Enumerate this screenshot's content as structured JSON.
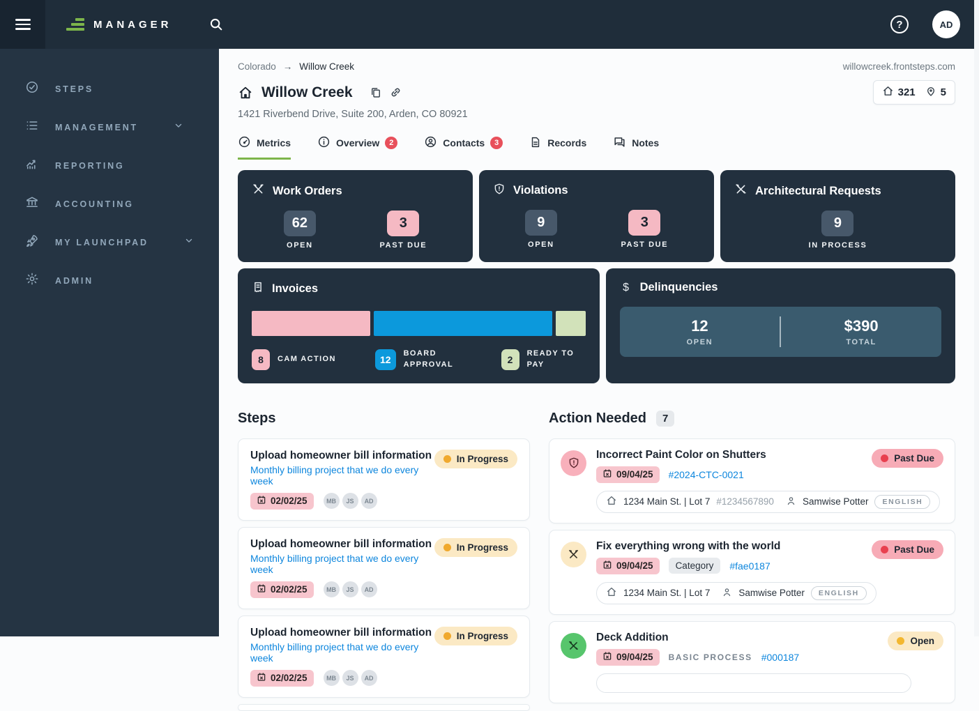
{
  "topbar": {
    "brand": "MANAGER",
    "help": "?",
    "avatar": "AD"
  },
  "sidebar": {
    "items": [
      {
        "label": "STEPS",
        "icon": "check-circle-icon",
        "expandable": false
      },
      {
        "label": "MANAGEMENT",
        "icon": "list-icon",
        "expandable": true
      },
      {
        "label": "REPORTING",
        "icon": "chart-icon",
        "expandable": false
      },
      {
        "label": "ACCOUNTING",
        "icon": "bank-icon",
        "expandable": false
      },
      {
        "label": "MY LAUNCHPAD",
        "icon": "rocket-icon",
        "expandable": true
      },
      {
        "label": "ADMIN",
        "icon": "gear-icon",
        "expandable": false
      }
    ]
  },
  "breadcrumb": {
    "parent": "Colorado",
    "current": "Willow Creek",
    "domain": "willowcreek.frontsteps.com"
  },
  "property": {
    "name": "Willow Creek",
    "address": "1421 Riverbend Drive, Suite 200, Arden, CO 80921",
    "homes_count": "321",
    "locations_count": "5"
  },
  "tabs": [
    {
      "label": "Metrics",
      "badge": "",
      "active": true
    },
    {
      "label": "Overview",
      "badge": "2",
      "active": false
    },
    {
      "label": "Contacts",
      "badge": "3",
      "active": false
    },
    {
      "label": "Records",
      "badge": "",
      "active": false
    },
    {
      "label": "Notes",
      "badge": "",
      "active": false
    }
  ],
  "metrics": {
    "work_orders": {
      "title": "Work Orders",
      "open": "62",
      "open_label": "OPEN",
      "past_due": "3",
      "past_due_label": "PAST DUE"
    },
    "violations": {
      "title": "Violations",
      "open": "9",
      "open_label": "OPEN",
      "past_due": "3",
      "past_due_label": "PAST DUE"
    },
    "architectural": {
      "title": "Architectural Requests",
      "value": "9",
      "label": "IN PROCESS"
    },
    "invoices": {
      "title": "Invoices",
      "segments": [
        {
          "value": 8,
          "label": "CAM ACTION",
          "color": "#f5b9c3",
          "text": "#1c2530"
        },
        {
          "value": 12,
          "label": "BOARD APPROVAL",
          "color": "#0c99dc",
          "text": "#ffffff"
        },
        {
          "value": 2,
          "label": "READY TO PAY",
          "color": "#d2e2ba",
          "text": "#1c2530"
        }
      ]
    },
    "delinquencies": {
      "title": "Delinquencies",
      "open": "12",
      "open_label": "OPEN",
      "total": "$390",
      "total_label": "TOTAL"
    }
  },
  "chart_data": {
    "type": "bar",
    "title": "Invoices",
    "categories": [
      "CAM ACTION",
      "BOARD APPROVAL",
      "READY TO PAY"
    ],
    "values": [
      8,
      12,
      2
    ],
    "colors": [
      "#f5b9c3",
      "#0c99dc",
      "#d2e2ba"
    ],
    "legend_position": "bottom"
  },
  "steps": {
    "heading": "Steps",
    "items": [
      {
        "title": "Upload homeowner bill information",
        "subtitle": "Monthly billing project that we do every week",
        "date": "02/02/25",
        "assignees": [
          "MB",
          "JS",
          "AD"
        ],
        "status": "In Progress"
      },
      {
        "title": "Upload homeowner bill information",
        "subtitle": "Monthly billing project that we do every week",
        "date": "02/02/25",
        "assignees": [
          "MB",
          "JS",
          "AD"
        ],
        "status": "In Progress"
      },
      {
        "title": "Upload homeowner bill information",
        "subtitle": "Monthly billing project that we do every week",
        "date": "02/02/25",
        "assignees": [
          "MB",
          "JS",
          "AD"
        ],
        "status": "In Progress"
      }
    ]
  },
  "action_needed": {
    "heading": "Action Needed",
    "count": "7",
    "items": [
      {
        "title": "Incorrect Paint Color on Shutters",
        "date": "09/04/25",
        "reference": "#2024-CTC-0021",
        "status": "Past Due",
        "address": "1234 Main St. | Lot 7",
        "account": "#1234567890",
        "person": "Samwise Potter",
        "language": "ENGLISH"
      },
      {
        "title": "Fix everything wrong with the world",
        "date": "09/04/25",
        "category": "Category",
        "reference": "#fae0187",
        "status": "Past Due",
        "address": "1234 Main St. | Lot 7",
        "person": "Samwise Potter",
        "language": "ENGLISH"
      },
      {
        "title": "Deck Addition",
        "date": "09/04/25",
        "process": "BASIC PROCESS",
        "reference": "#000187",
        "status": "Open"
      }
    ]
  }
}
